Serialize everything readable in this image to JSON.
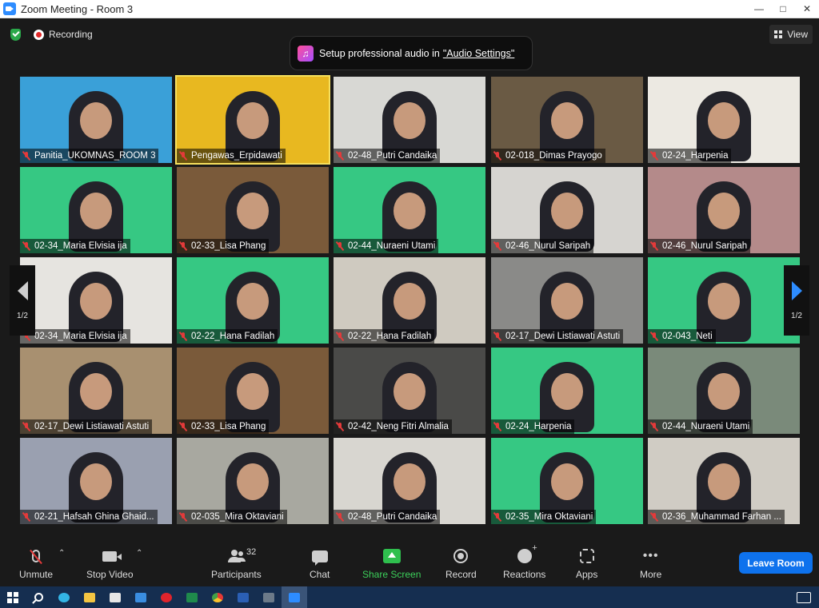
{
  "window": {
    "title": "Zoom Meeting - Room 3",
    "controls": [
      "—",
      "□",
      "✕"
    ]
  },
  "topbar": {
    "recording_label": "Recording",
    "view_label": "View"
  },
  "banner": {
    "text": "Setup professional audio in",
    "link": "\"Audio Settings\""
  },
  "nav": {
    "page_indicator": "1/2"
  },
  "tiles": [
    {
      "name": "Panitia_UKOMNAS_ROOM 3",
      "bg": "#3aa0d8",
      "active": false
    },
    {
      "name": "Pengawas_Erpidawati",
      "bg": "#e8b820",
      "active": true
    },
    {
      "name": "02-48_Putri Candaika",
      "bg": "#d8d8d4",
      "active": false
    },
    {
      "name": "02-018_Dimas Prayogo",
      "bg": "#6a5a44",
      "active": false
    },
    {
      "name": "02-24_Harpenia",
      "bg": "#ece9e2",
      "active": false
    },
    {
      "name": "02-34_Maria Elvisia ija",
      "bg": "#36c883",
      "active": false
    },
    {
      "name": "02-33_Lisa Phang",
      "bg": "#7a5a3a",
      "active": false
    },
    {
      "name": "02-44_Nuraeni Utami",
      "bg": "#36c883",
      "active": false
    },
    {
      "name": "02-46_Nurul Saripah",
      "bg": "#d6d4d0",
      "active": false
    },
    {
      "name": "02-46_Nurul Saripah",
      "bg": "#b48a8a",
      "active": false
    },
    {
      "name": "02-34_Maria Elvisia ija",
      "bg": "#e6e4e0",
      "active": false
    },
    {
      "name": "02-22_Hana Fadilah",
      "bg": "#36c883",
      "active": false
    },
    {
      "name": "02-22_Hana Fadilah",
      "bg": "#cfcac0",
      "active": false
    },
    {
      "name": "02-17_Dewi Listiawati Astuti",
      "bg": "#8a8a88",
      "active": false
    },
    {
      "name": "02-043_Neti",
      "bg": "#36c883",
      "active": false
    },
    {
      "name": "02-17_Dewi Listiawati Astuti",
      "bg": "#a89070",
      "active": false
    },
    {
      "name": "02-33_Lisa Phang",
      "bg": "#7a5a3a",
      "active": false
    },
    {
      "name": "02-42_Neng Fitri Almalia",
      "bg": "#4a4a48",
      "active": false
    },
    {
      "name": "02-24_Harpenia",
      "bg": "#36c883",
      "active": false
    },
    {
      "name": "02-44_Nuraeni Utami",
      "bg": "#7a8a7a",
      "active": false
    },
    {
      "name": "02-21_Hafsah Ghina Ghaid...",
      "bg": "#9aa0b0",
      "active": false
    },
    {
      "name": "02-035_Mira Oktaviani",
      "bg": "#a8a8a0",
      "active": false
    },
    {
      "name": "02-48_Putri Candaika",
      "bg": "#d8d6d0",
      "active": false
    },
    {
      "name": "02-35_Mira Oktaviani",
      "bg": "#36c883",
      "active": false
    },
    {
      "name": "02-36_Muhammad Farhan ...",
      "bg": "#d0ccc4",
      "active": false
    }
  ],
  "toolbar": {
    "unmute": "Unmute",
    "stop_video": "Stop Video",
    "participants": "Participants",
    "participants_count": "32",
    "chat": "Chat",
    "share_screen": "Share Screen",
    "record": "Record",
    "reactions": "Reactions",
    "apps": "Apps",
    "more": "More",
    "leave": "Leave Room"
  },
  "taskbar": {
    "apps": [
      "start-icon",
      "search-icon",
      "edge-icon",
      "file-explorer-icon",
      "store-icon",
      "mail-icon",
      "opera-icon",
      "excel-icon",
      "chrome-icon",
      "word-icon",
      "calculator-icon",
      "zoom-icon",
      "notifications-icon"
    ]
  }
}
